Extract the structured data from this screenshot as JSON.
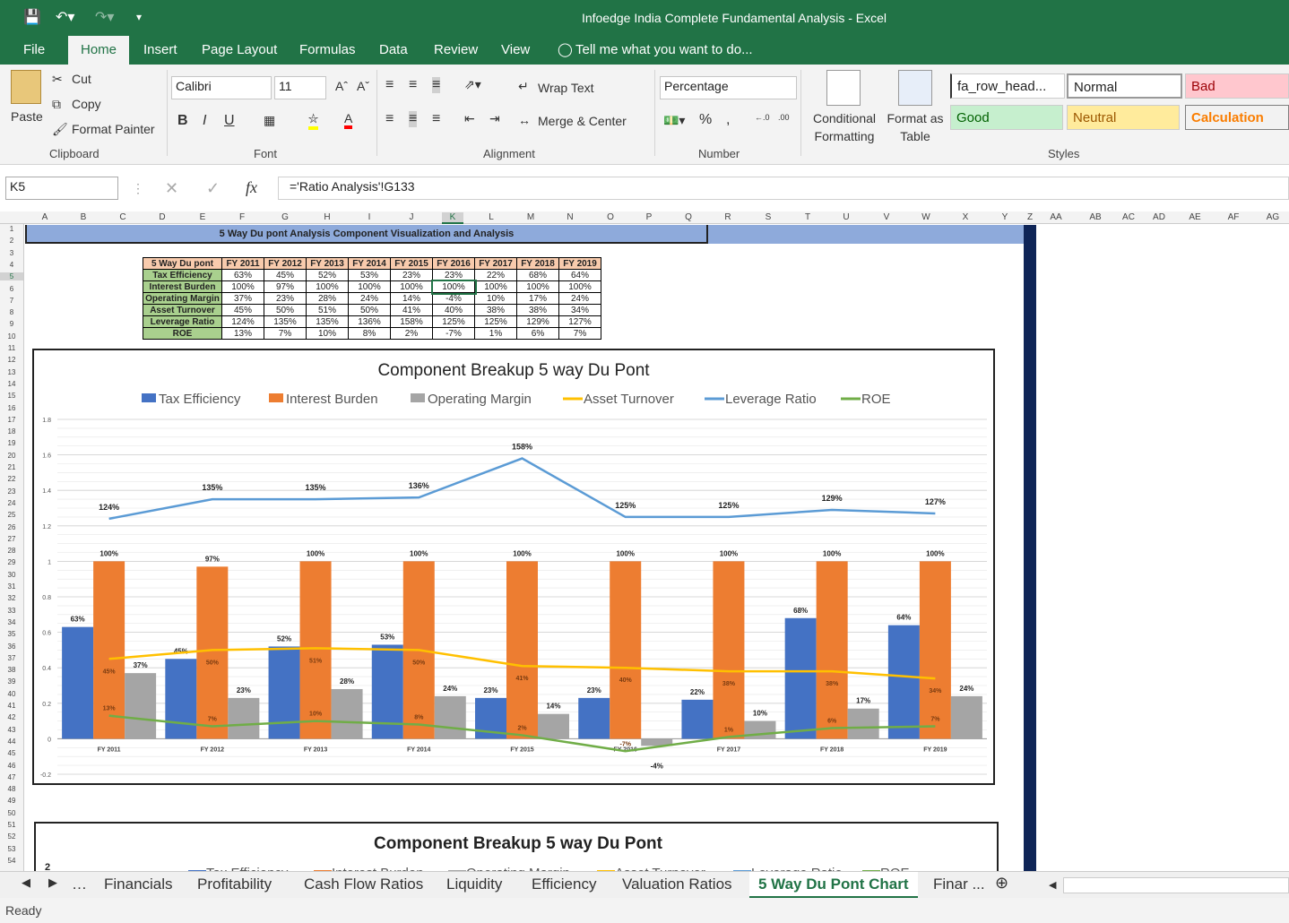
{
  "window": {
    "title": "Infoedge India Complete Fundamental Analysis - Excel"
  },
  "ribbon_tabs": [
    "File",
    "Home",
    "Insert",
    "Page Layout",
    "Formulas",
    "Data",
    "Review",
    "View"
  ],
  "tell_me": "Tell me what you want to do...",
  "clipboard": {
    "paste": "Paste",
    "cut": "Cut",
    "copy": "Copy",
    "format_painter": "Format Painter",
    "label": "Clipboard"
  },
  "font": {
    "name": "Calibri",
    "size": "11",
    "label": "Font",
    "bold": "B",
    "italic": "I",
    "underline": "U"
  },
  "alignment": {
    "wrap": "Wrap Text",
    "merge": "Merge & Center",
    "label": "Alignment"
  },
  "number": {
    "format": "Percentage",
    "label": "Number",
    "percent": "%",
    "comma": ","
  },
  "styles": {
    "conditional": "Conditional Formatting",
    "format_table": "Format as Table",
    "label": "Styles",
    "cells": [
      {
        "name": "fa_row_head...",
        "bg": "#ffffff",
        "fg": "#222222"
      },
      {
        "name": "Normal",
        "bg": "#ffffff",
        "fg": "#222222"
      },
      {
        "name": "Bad",
        "bg": "#ffc7ce",
        "fg": "#9c0006"
      },
      {
        "name": "Good",
        "bg": "#c6efce",
        "fg": "#006100"
      },
      {
        "name": "Neutral",
        "bg": "#ffeb9c",
        "fg": "#9c5700"
      },
      {
        "name": "Calculation",
        "bg": "#f2f2f2",
        "fg": "#fa7d00"
      }
    ]
  },
  "formula_bar": {
    "name_box": "K5",
    "formula": "='Ratio Analysis'!G133",
    "fx": "fx"
  },
  "columns": [
    "A",
    "B",
    "C",
    "D",
    "E",
    "F",
    "G",
    "H",
    "I",
    "J",
    "K",
    "L",
    "M",
    "N",
    "O",
    "P",
    "Q",
    "R",
    "S",
    "T",
    "U",
    "V",
    "W",
    "X",
    "Y",
    "Z",
    "AA",
    "AB",
    "AC",
    "AD",
    "AE",
    "AF",
    "AG"
  ],
  "banner": "5 Way Du pont Analysis Component Visualization and Analysis",
  "table": {
    "header": [
      "5 Way Du pont",
      "FY 2011",
      "FY 2012",
      "FY 2013",
      "FY 2014",
      "FY 2015",
      "FY 2016",
      "FY 2017",
      "FY 2018",
      "FY 2019"
    ],
    "rows": [
      [
        "Tax Efficiency",
        "63%",
        "45%",
        "52%",
        "53%",
        "23%",
        "23%",
        "22%",
        "68%",
        "64%"
      ],
      [
        "Interest Burden",
        "100%",
        "97%",
        "100%",
        "100%",
        "100%",
        "100%",
        "100%",
        "100%",
        "100%"
      ],
      [
        "Operating Margin",
        "37%",
        "23%",
        "28%",
        "24%",
        "14%",
        "-4%",
        "10%",
        "17%",
        "24%"
      ],
      [
        "Asset Turnover",
        "45%",
        "50%",
        "51%",
        "50%",
        "41%",
        "40%",
        "38%",
        "38%",
        "34%"
      ],
      [
        "Leverage Ratio",
        "124%",
        "135%",
        "135%",
        "136%",
        "158%",
        "125%",
        "125%",
        "129%",
        "127%"
      ],
      [
        "ROE",
        "13%",
        "7%",
        "10%",
        "8%",
        "2%",
        "-7%",
        "1%",
        "6%",
        "7%"
      ]
    ]
  },
  "chart_data": [
    {
      "type": "bar",
      "title": "Component Breakup 5 way Du Pont",
      "categories": [
        "FY 2011",
        "FY 2012",
        "FY 2013",
        "FY 2014",
        "FY 2015",
        "FY 2016",
        "FY 2017",
        "FY 2018",
        "FY 2019"
      ],
      "ylim": [
        -0.2,
        1.8
      ],
      "yticks": [
        "-0.2",
        "0",
        "0.2",
        "0.4",
        "0.6",
        "0.8",
        "1",
        "1.2",
        "1.4",
        "1.6",
        "1.8"
      ],
      "grid": true,
      "legend": "top",
      "series": [
        {
          "name": "Tax Efficiency",
          "kind": "bar",
          "color": "#4472c4",
          "values": [
            0.63,
            0.45,
            0.52,
            0.53,
            0.23,
            0.23,
            0.22,
            0.68,
            0.64
          ],
          "labels": [
            "63%",
            "45%",
            "52%",
            "53%",
            "23%",
            "23%",
            "22%",
            "68%",
            "64%"
          ]
        },
        {
          "name": "Interest Burden",
          "kind": "bar",
          "color": "#ed7d31",
          "values": [
            1.0,
            0.97,
            1.0,
            1.0,
            1.0,
            1.0,
            1.0,
            1.0,
            1.0
          ],
          "labels": [
            "100%",
            "97%",
            "100%",
            "100%",
            "100%",
            "100%",
            "100%",
            "100%",
            "100%"
          ]
        },
        {
          "name": "Operating Margin",
          "kind": "bar",
          "color": "#a5a5a5",
          "values": [
            0.37,
            0.23,
            0.28,
            0.24,
            0.14,
            -0.04,
            0.1,
            0.17,
            0.24
          ],
          "labels": [
            "37%",
            "23%",
            "28%",
            "24%",
            "14%",
            "-4%",
            "10%",
            "17%",
            "24%"
          ]
        },
        {
          "name": "Asset Turnover",
          "kind": "line",
          "color": "#ffc000",
          "values": [
            0.45,
            0.5,
            0.51,
            0.5,
            0.41,
            0.4,
            0.38,
            0.38,
            0.34
          ],
          "labels": [
            "45%",
            "50%",
            "51%",
            "50%",
            "41%",
            "40%",
            "38%",
            "38%",
            "34%"
          ]
        },
        {
          "name": "Leverage Ratio",
          "kind": "line",
          "color": "#5b9bd5",
          "values": [
            1.24,
            1.35,
            1.35,
            1.36,
            1.58,
            1.25,
            1.25,
            1.29,
            1.27
          ],
          "labels": [
            "124%",
            "135%",
            "135%",
            "136%",
            "158%",
            "125%",
            "125%",
            "129%",
            "127%"
          ]
        },
        {
          "name": "ROE",
          "kind": "line",
          "color": "#70ad47",
          "values": [
            0.13,
            0.07,
            0.1,
            0.08,
            0.02,
            -0.07,
            0.01,
            0.06,
            0.07
          ],
          "labels": [
            "13%",
            "7%",
            "10%",
            "8%",
            "2%",
            "-7%",
            "1%",
            "6%",
            "7%"
          ]
        }
      ]
    },
    {
      "type": "bar",
      "title": "Component Breakup 5 way Du Pont",
      "first_tick": "2",
      "series": [
        {
          "name": "Tax Efficiency"
        },
        {
          "name": "Interest Burden"
        },
        {
          "name": "Operating Margin"
        },
        {
          "name": "Asset Turnover"
        },
        {
          "name": "Leverage Ratio"
        },
        {
          "name": "ROE"
        }
      ]
    }
  ],
  "sheet_tabs": [
    "Financials",
    "Profitability",
    "Cash Flow Ratios",
    "Liquidity",
    "Efficiency",
    "Valuation Ratios",
    "5 Way Du Pont Chart",
    "Finar ..."
  ],
  "active_sheet": "5 Way Du Pont Chart",
  "status": "Ready"
}
